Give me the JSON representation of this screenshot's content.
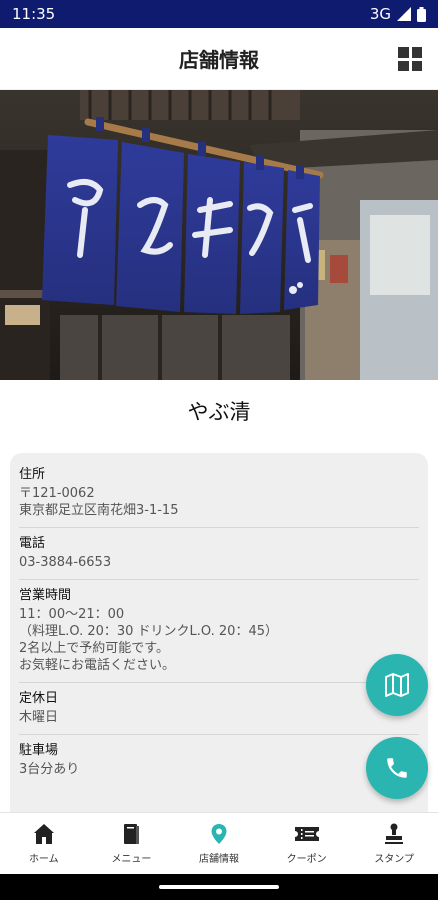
{
  "status_bar": {
    "time": "11:35",
    "network": "3G"
  },
  "header": {
    "title": "店舗情報",
    "menu_icon": "grid-icon"
  },
  "hero": {
    "image": "shop-noren-photo"
  },
  "shop": {
    "name": "やぶ清"
  },
  "info": {
    "address": {
      "label": "住所",
      "value": "〒121-0062\n東京都足立区南花畑3-1-15"
    },
    "phone": {
      "label": "電話",
      "value": "03-3884-6653"
    },
    "hours": {
      "label": "営業時間",
      "value": "11：00〜21：00\n（料理L.O. 20：30 ドリンクL.O. 20：45）\n2名以上で予約可能です。\nお気軽にお電話ください。"
    },
    "closed": {
      "label": "定休日",
      "value": "木曜日"
    },
    "parking": {
      "label": "駐車場",
      "value": "3台分あり"
    }
  },
  "fabs": {
    "map_icon": "map-icon",
    "phone_icon": "phone-icon",
    "color": "#2ab5b0"
  },
  "nav": {
    "items": [
      {
        "label": "ホーム",
        "icon": "home-icon"
      },
      {
        "label": "メニュー",
        "icon": "book-icon"
      },
      {
        "label": "店舗情報",
        "icon": "location-pin-icon"
      },
      {
        "label": "クーポン",
        "icon": "ticket-icon"
      },
      {
        "label": "スタンプ",
        "icon": "stamp-icon"
      }
    ],
    "active_color": "#2ab5b0"
  },
  "colors": {
    "status_bar": "#0e1b6e",
    "accent": "#2ab5b0",
    "card_bg": "#efefef"
  }
}
